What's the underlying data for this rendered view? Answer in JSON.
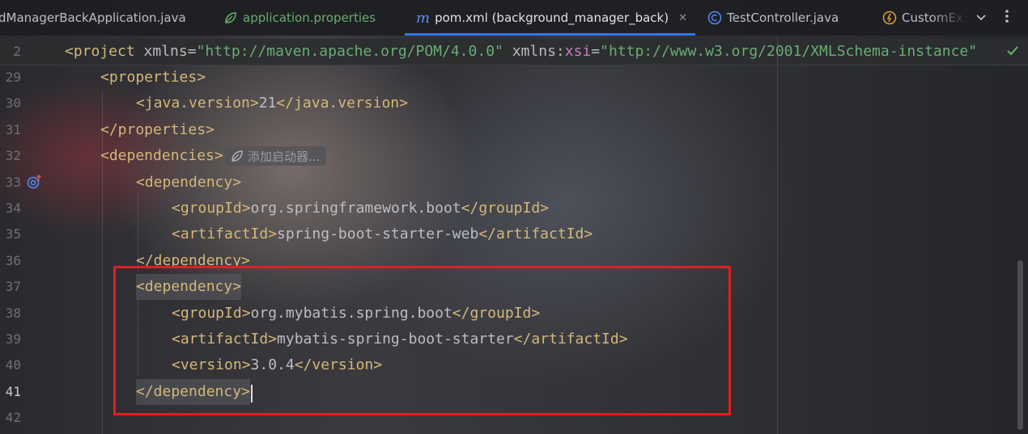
{
  "tabs": [
    {
      "label": "dManagerBackApplication.java",
      "icon": "none"
    },
    {
      "label": "application.properties",
      "icon": "spring-leaf-icon"
    },
    {
      "label": "pom.xml (background_manager_back)",
      "icon": "maven-icon",
      "active": true
    },
    {
      "label": "TestController.java",
      "icon": "class-icon"
    },
    {
      "label": "CustomEx",
      "icon": "exception-class-icon"
    }
  ],
  "tab_close": "✕",
  "maven_glyph": "m",
  "sticky": {
    "line": "2",
    "open_tag": "<project",
    "attr1": "xmlns",
    "eq1": "=",
    "val1": "\"http://maven.apache.org/POM/4.0.0\"",
    "attr2a": "xmlns",
    "colon": ":",
    "attr2b": "xsi",
    "eq2": "=",
    "val2": "\"http://www.w3.org/2001/XMLSchema-instance\""
  },
  "hint_text": "添加启动器...",
  "lines": [
    {
      "num": "29",
      "parts": [
        {
          "c": "tag",
          "t": "<properties>"
        }
      ]
    },
    {
      "num": "30",
      "parts": [
        {
          "c": "tag",
          "t": "<java.version>"
        },
        {
          "c": "txt",
          "t": "21"
        },
        {
          "c": "tag",
          "t": "</java.version>"
        }
      ]
    },
    {
      "num": "31",
      "parts": [
        {
          "c": "tag",
          "t": "</properties>"
        }
      ]
    },
    {
      "num": "32",
      "parts": [
        {
          "c": "tag",
          "t": "<dependencies>"
        }
      ]
    },
    {
      "num": "33",
      "parts": [
        {
          "c": "tag",
          "t": "<dependency>"
        }
      ]
    },
    {
      "num": "34",
      "parts": [
        {
          "c": "tag",
          "t": "<groupId>"
        },
        {
          "c": "txt",
          "t": "org.springframework.boot"
        },
        {
          "c": "tag",
          "t": "</groupId>"
        }
      ]
    },
    {
      "num": "35",
      "parts": [
        {
          "c": "tag",
          "t": "<artifactId>"
        },
        {
          "c": "txt",
          "t": "spring-boot-starter-web"
        },
        {
          "c": "tag",
          "t": "</artifactId>"
        }
      ]
    },
    {
      "num": "36",
      "parts": [
        {
          "c": "tag",
          "t": "</dependency>"
        }
      ]
    },
    {
      "num": "37",
      "parts": [
        {
          "c": "tag",
          "t": "<dependency>"
        }
      ]
    },
    {
      "num": "38",
      "parts": [
        {
          "c": "tag",
          "t": "<groupId>"
        },
        {
          "c": "txt",
          "t": "org.mybatis.spring.boot"
        },
        {
          "c": "tag",
          "t": "</groupId>"
        }
      ]
    },
    {
      "num": "39",
      "parts": [
        {
          "c": "tag",
          "t": "<artifactId>"
        },
        {
          "c": "txt",
          "t": "mybatis-spring-boot-starter"
        },
        {
          "c": "tag",
          "t": "</artifactId>"
        }
      ]
    },
    {
      "num": "40",
      "parts": [
        {
          "c": "tag",
          "t": "<version>"
        },
        {
          "c": "txt",
          "t": "3.0.4"
        },
        {
          "c": "tag",
          "t": "</version>"
        }
      ]
    },
    {
      "num": "41",
      "parts": [
        {
          "c": "tag",
          "t": "</dependency>"
        }
      ]
    },
    {
      "num": "42",
      "parts": []
    }
  ],
  "colors": {
    "accent": "#3574f0",
    "tag": "#d5b778",
    "string": "#6aab73",
    "namespace": "#c77dbb",
    "highlight_box": "#e02020",
    "ok_check": "#5fb865"
  }
}
